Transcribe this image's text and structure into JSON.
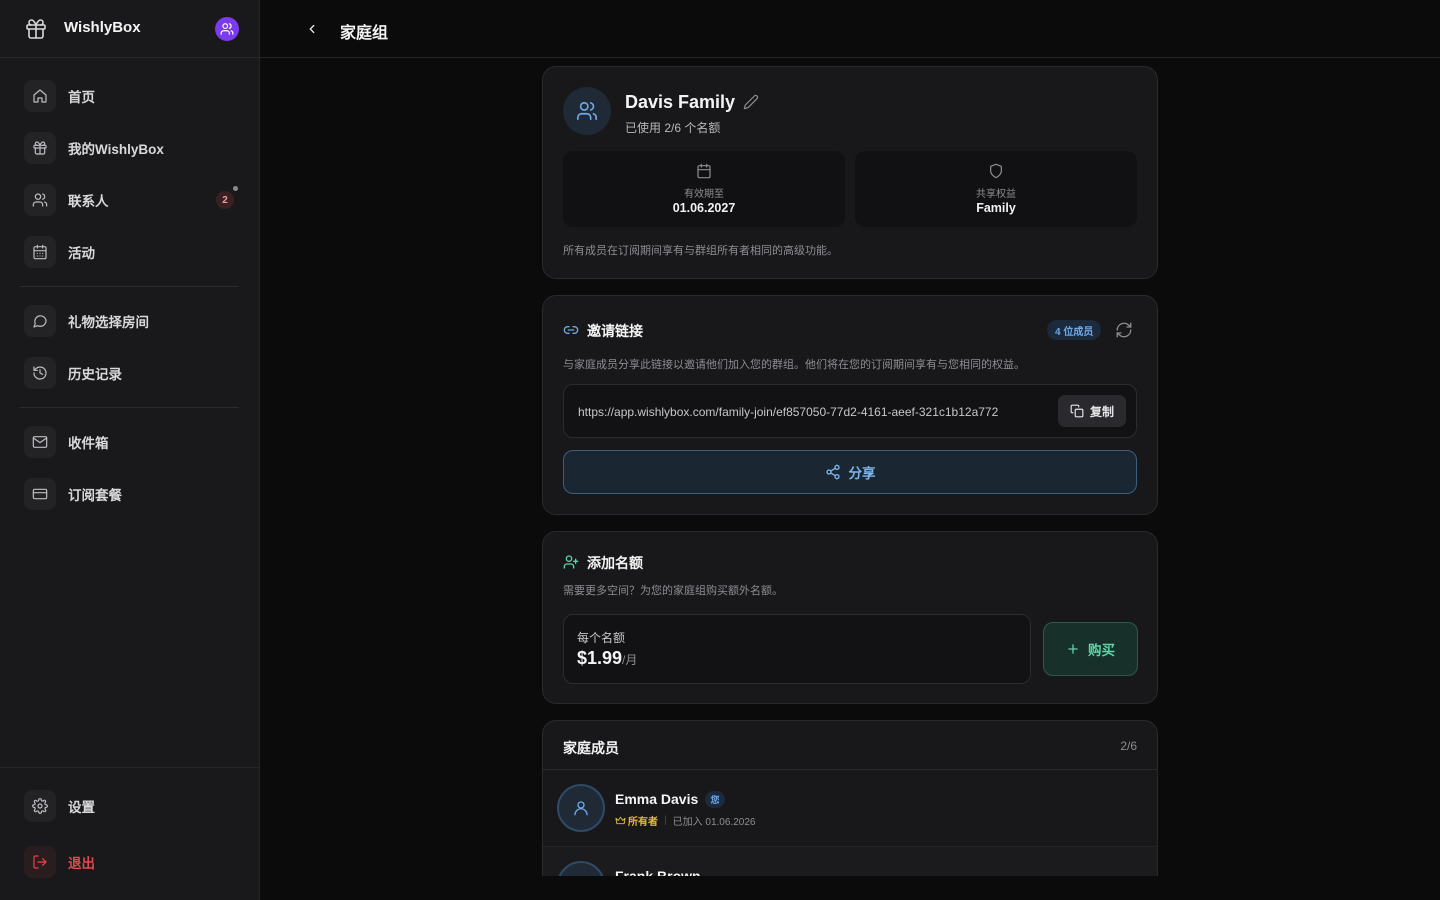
{
  "sidebar": {
    "brand": "WishlyBox",
    "nav": [
      {
        "label": "首页",
        "icon": "home-icon"
      },
      {
        "label": "我的WishlyBox",
        "icon": "gift-icon"
      },
      {
        "label": "联系人",
        "icon": "users-icon",
        "badge": "2"
      },
      {
        "label": "活动",
        "icon": "calendar-icon"
      },
      {
        "label": "礼物选择房间",
        "icon": "chat-bubble-icon"
      },
      {
        "label": "历史记录",
        "icon": "history-icon"
      },
      {
        "label": "收件箱",
        "icon": "mail-icon"
      },
      {
        "label": "订阅套餐",
        "icon": "credit-card-icon"
      }
    ],
    "settings": "设置",
    "logout": "退出"
  },
  "header": {
    "title": "家庭组"
  },
  "group": {
    "name": "Davis Family",
    "usage": "已使用 2/6 个名额",
    "expiry_label": "有效期至",
    "expiry_value": "01.06.2027",
    "benefit_label": "共享权益",
    "benefit_value": "Family",
    "note": "所有成员在订阅期间享有与群组所有者相同的高级功能。"
  },
  "invite": {
    "title": "邀请链接",
    "member_chip": "4 位成员",
    "description": "与家庭成员分享此链接以邀请他们加入您的群组。他们将在您的订阅期间享有与您相同的权益。",
    "link": "https://app.wishlybox.com/family-join/ef857050-77d2-4161-aeef-321c1b12a772",
    "copy_label": "复制",
    "share_label": "分享"
  },
  "add_seats": {
    "title": "添加名额",
    "description": "需要更多空间？为您的家庭组购买额外名额。",
    "price_label": "每个名额",
    "price": "$1.99",
    "price_unit": "/月",
    "buy_label": "购买"
  },
  "members": {
    "title": "家庭成员",
    "count": "2/6",
    "list": [
      {
        "name": "Emma Davis",
        "you_label": "您",
        "role": "所有者",
        "joined": "已加入 01.06.2026"
      },
      {
        "name": "Frank Brown"
      }
    ]
  },
  "colors": {
    "accent_blue": "#6fa8e8",
    "accent_green": "#5fd4a8",
    "brand_purple": "#7c3aed",
    "danger": "#e5484d",
    "owner_gold": "#e8b93c"
  }
}
